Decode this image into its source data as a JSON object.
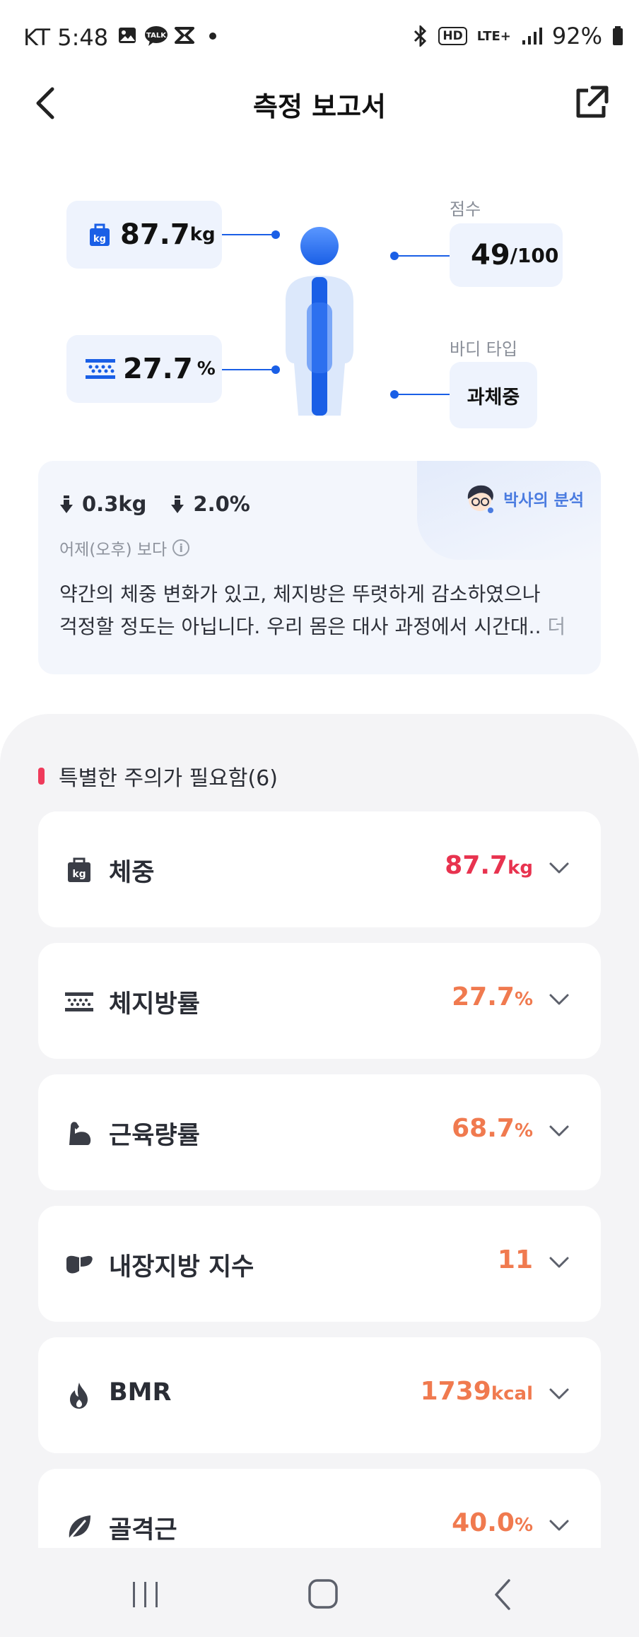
{
  "status_bar": {
    "carrier_time": "KT 5:48",
    "talk_badge": "TALK",
    "network": "LTE+",
    "hd": "HD",
    "battery": "92%"
  },
  "header": {
    "title": "측정 보고서"
  },
  "summary": {
    "weight": {
      "value": "87.7",
      "unit": "kg"
    },
    "body_fat": {
      "value": "27.7",
      "unit": "%"
    },
    "score": {
      "label": "점수",
      "value": "49",
      "max": "/100"
    },
    "body_type": {
      "label": "바디 타입",
      "value": "과체중"
    }
  },
  "analysis": {
    "weight_change": "0.3kg",
    "fat_change": "2.0%",
    "compare_label": "어제(오후) 보다",
    "doctor_label": "박사의 분석",
    "text_line1": "약간의 체중 변화가 있고, 체지방은 뚜렷하게 감소하였으나",
    "text_line2": "걱정할 정도는 아닙니다.  우리 몸은 대사 과정에서 시간대..",
    "more": "더"
  },
  "attention": {
    "heading": "특별한 주의가 필요함(6)",
    "items": [
      {
        "name": "체중",
        "value": "87.7",
        "unit": "kg",
        "icon": "weight-icon",
        "color": "#e8334f"
      },
      {
        "name": "체지방률",
        "value": "27.7",
        "unit": "%",
        "icon": "body-fat-icon",
        "color": "#f07a4f"
      },
      {
        "name": "근육량률",
        "value": "68.7",
        "unit": "%",
        "icon": "muscle-icon",
        "color": "#f07a4f"
      },
      {
        "name": "내장지방 지수",
        "value": "11",
        "unit": "",
        "icon": "visceral-fat-icon",
        "color": "#f07a4f"
      },
      {
        "name": "BMR",
        "value": "1739",
        "unit": "kcal",
        "icon": "flame-icon",
        "color": "#f07a4f"
      },
      {
        "name": "골격근",
        "value": "40.0",
        "unit": "%",
        "icon": "leaf-icon",
        "color": "#f07a4f"
      }
    ]
  },
  "colors": {
    "accent": "#1a5fe6",
    "alert_red": "#e8334f",
    "alert_orange": "#f07a4f",
    "panel_bg": "#eef3fd"
  }
}
